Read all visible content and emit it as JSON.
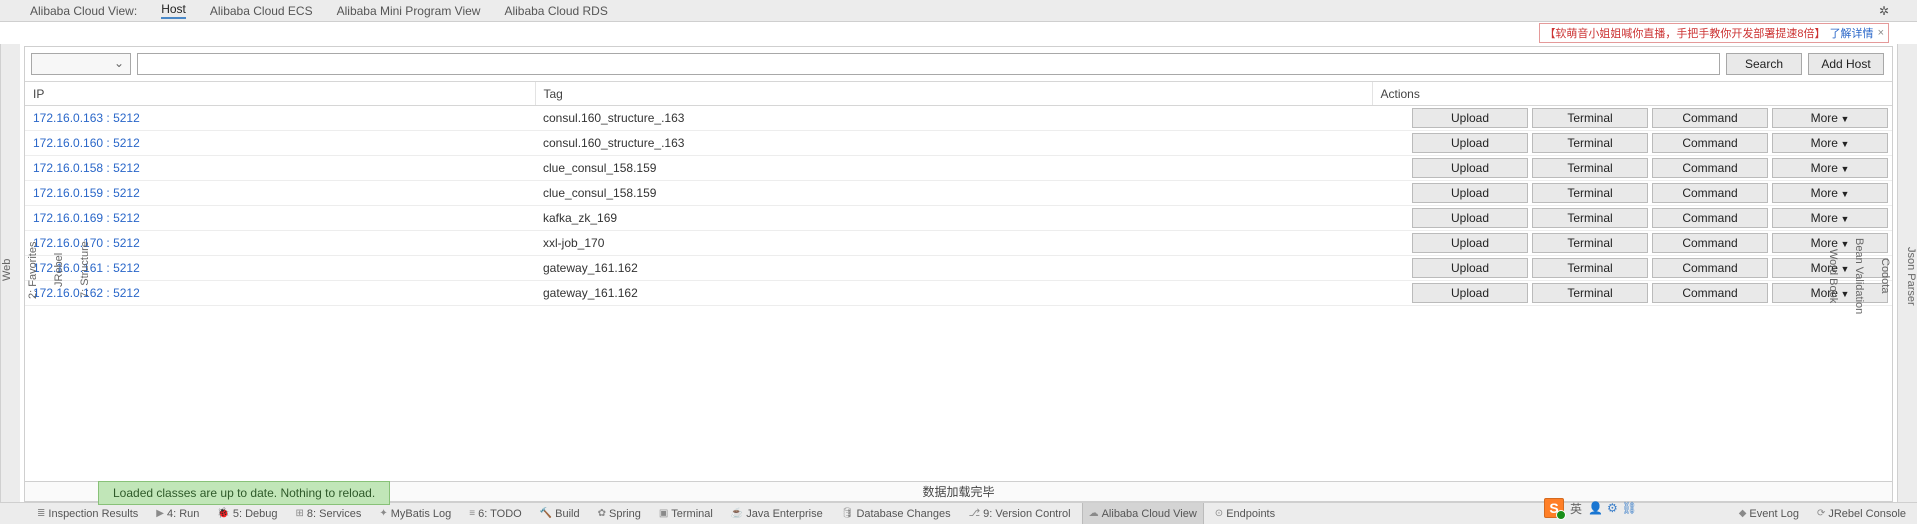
{
  "topTabs": {
    "items": [
      {
        "label": "Alibaba Cloud View:"
      },
      {
        "label": "Host",
        "active": true
      },
      {
        "label": "Alibaba Cloud ECS"
      },
      {
        "label": "Alibaba Mini Program View"
      },
      {
        "label": "Alibaba Cloud RDS"
      }
    ],
    "gear": "✲"
  },
  "banner": {
    "text": "【软萌音小姐姐喊你直播，手把手教你开发部署提速8倍】",
    "link": "了解详情",
    "close": "×"
  },
  "leftRail": [
    "Web",
    "2: Favorites",
    "JRebel",
    "7: Structure"
  ],
  "rightRail": [
    "Json Parser",
    "Codota",
    "Bean Validation",
    "Word Book"
  ],
  "filter": {
    "comboValue": "",
    "searchValue": "",
    "searchBtn": "Search",
    "addHostBtn": "Add Host"
  },
  "columns": {
    "ip": "IP",
    "tag": "Tag",
    "actions": "Actions"
  },
  "rowButtons": {
    "upload": "Upload",
    "terminal": "Terminal",
    "command": "Command",
    "more": "More"
  },
  "rows": [
    {
      "ip": "172.16.0.163 : 5212",
      "tag": "consul.160_structure_.163"
    },
    {
      "ip": "172.16.0.160 : 5212",
      "tag": "consul.160_structure_.163"
    },
    {
      "ip": "172.16.0.158 : 5212",
      "tag": "clue_consul_158.159"
    },
    {
      "ip": "172.16.0.159 : 5212",
      "tag": "clue_consul_158.159"
    },
    {
      "ip": "172.16.0.169 : 5212",
      "tag": "kafka_zk_169"
    },
    {
      "ip": "172.16.0.170 : 5212",
      "tag": "xxl-job_170"
    },
    {
      "ip": "172.16.0.161 : 5212",
      "tag": "gateway_161.162"
    },
    {
      "ip": "172.16.0.162 : 5212",
      "tag": "gateway_161.162"
    }
  ],
  "status": "数据加载完毕",
  "toast": "Loaded classes are up to date. Nothing to reload.",
  "bottomBar": {
    "items": [
      {
        "ico": "≣",
        "label": "Inspection Results"
      },
      {
        "ico": "▶",
        "label": "4: Run",
        "underline": "4"
      },
      {
        "ico": "🐞",
        "label": "5: Debug",
        "underline": "5"
      },
      {
        "ico": "⊞",
        "label": "8: Services",
        "underline": "8"
      },
      {
        "ico": "✦",
        "label": "MyBatis Log"
      },
      {
        "ico": "≡",
        "label": "6: TODO",
        "underline": "6"
      },
      {
        "ico": "🔨",
        "label": "Build"
      },
      {
        "ico": "✿",
        "label": "Spring"
      },
      {
        "ico": "▣",
        "label": "Terminal"
      },
      {
        "ico": "☕",
        "label": "Java Enterprise"
      },
      {
        "ico": "🛢",
        "label": "Database Changes"
      },
      {
        "ico": "⎇",
        "label": "9: Version Control",
        "underline": "9"
      },
      {
        "ico": "☁",
        "label": "Alibaba Cloud View",
        "active": true
      },
      {
        "ico": "⊙",
        "label": "Endpoints"
      }
    ],
    "right": [
      {
        "ico": "◆",
        "label": "Event Log"
      },
      {
        "ico": "⟳",
        "label": "JRebel Console"
      }
    ]
  },
  "ime": {
    "badge": "S",
    "txt": "英",
    "icons": [
      "👤",
      "⚙",
      "⛓"
    ]
  }
}
